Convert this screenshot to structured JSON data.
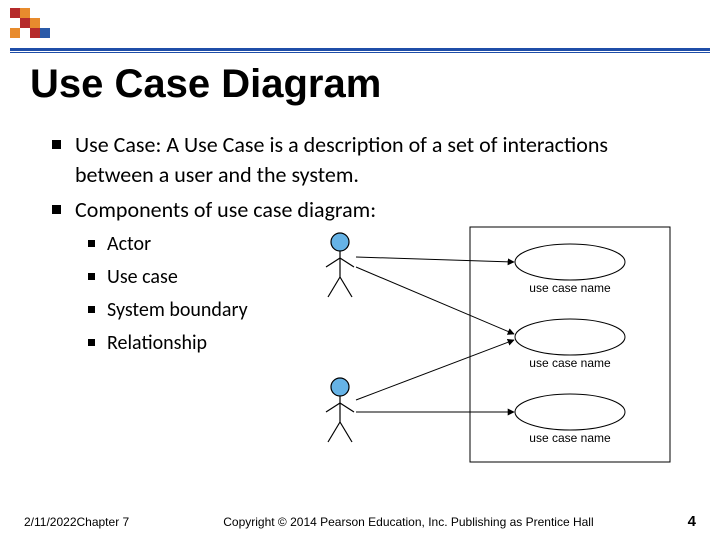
{
  "title": "Use Case Diagram",
  "bullets": {
    "b1": "Use Case: A Use Case is a description of a set of interactions between a user and the system.",
    "b2": "Components of use case diagram:",
    "sub": {
      "s1": "Actor",
      "s2": "Use case",
      "s3": "System boundary",
      "s4": "Relationship"
    }
  },
  "diagram": {
    "usecase_label": "use case name"
  },
  "footer": {
    "left": "2/11/2022Chapter 7",
    "center": "Copyright © 2014 Pearson Education, Inc. Publishing as Prentice Hall",
    "page": "4"
  },
  "chart_data": {
    "type": "diagram",
    "title": "Use Case Diagram",
    "actors": [
      {
        "id": "actor1",
        "position": "upper-left"
      },
      {
        "id": "actor2",
        "position": "lower-left"
      }
    ],
    "use_cases": [
      {
        "id": "uc1",
        "label": "use case name"
      },
      {
        "id": "uc2",
        "label": "use case name"
      },
      {
        "id": "uc3",
        "label": "use case name"
      }
    ],
    "system_boundary": true,
    "relationships": [
      {
        "from": "actor1",
        "to": "uc1"
      },
      {
        "from": "actor1",
        "to": "uc2"
      },
      {
        "from": "actor2",
        "to": "uc2"
      },
      {
        "from": "actor2",
        "to": "uc3"
      }
    ]
  }
}
